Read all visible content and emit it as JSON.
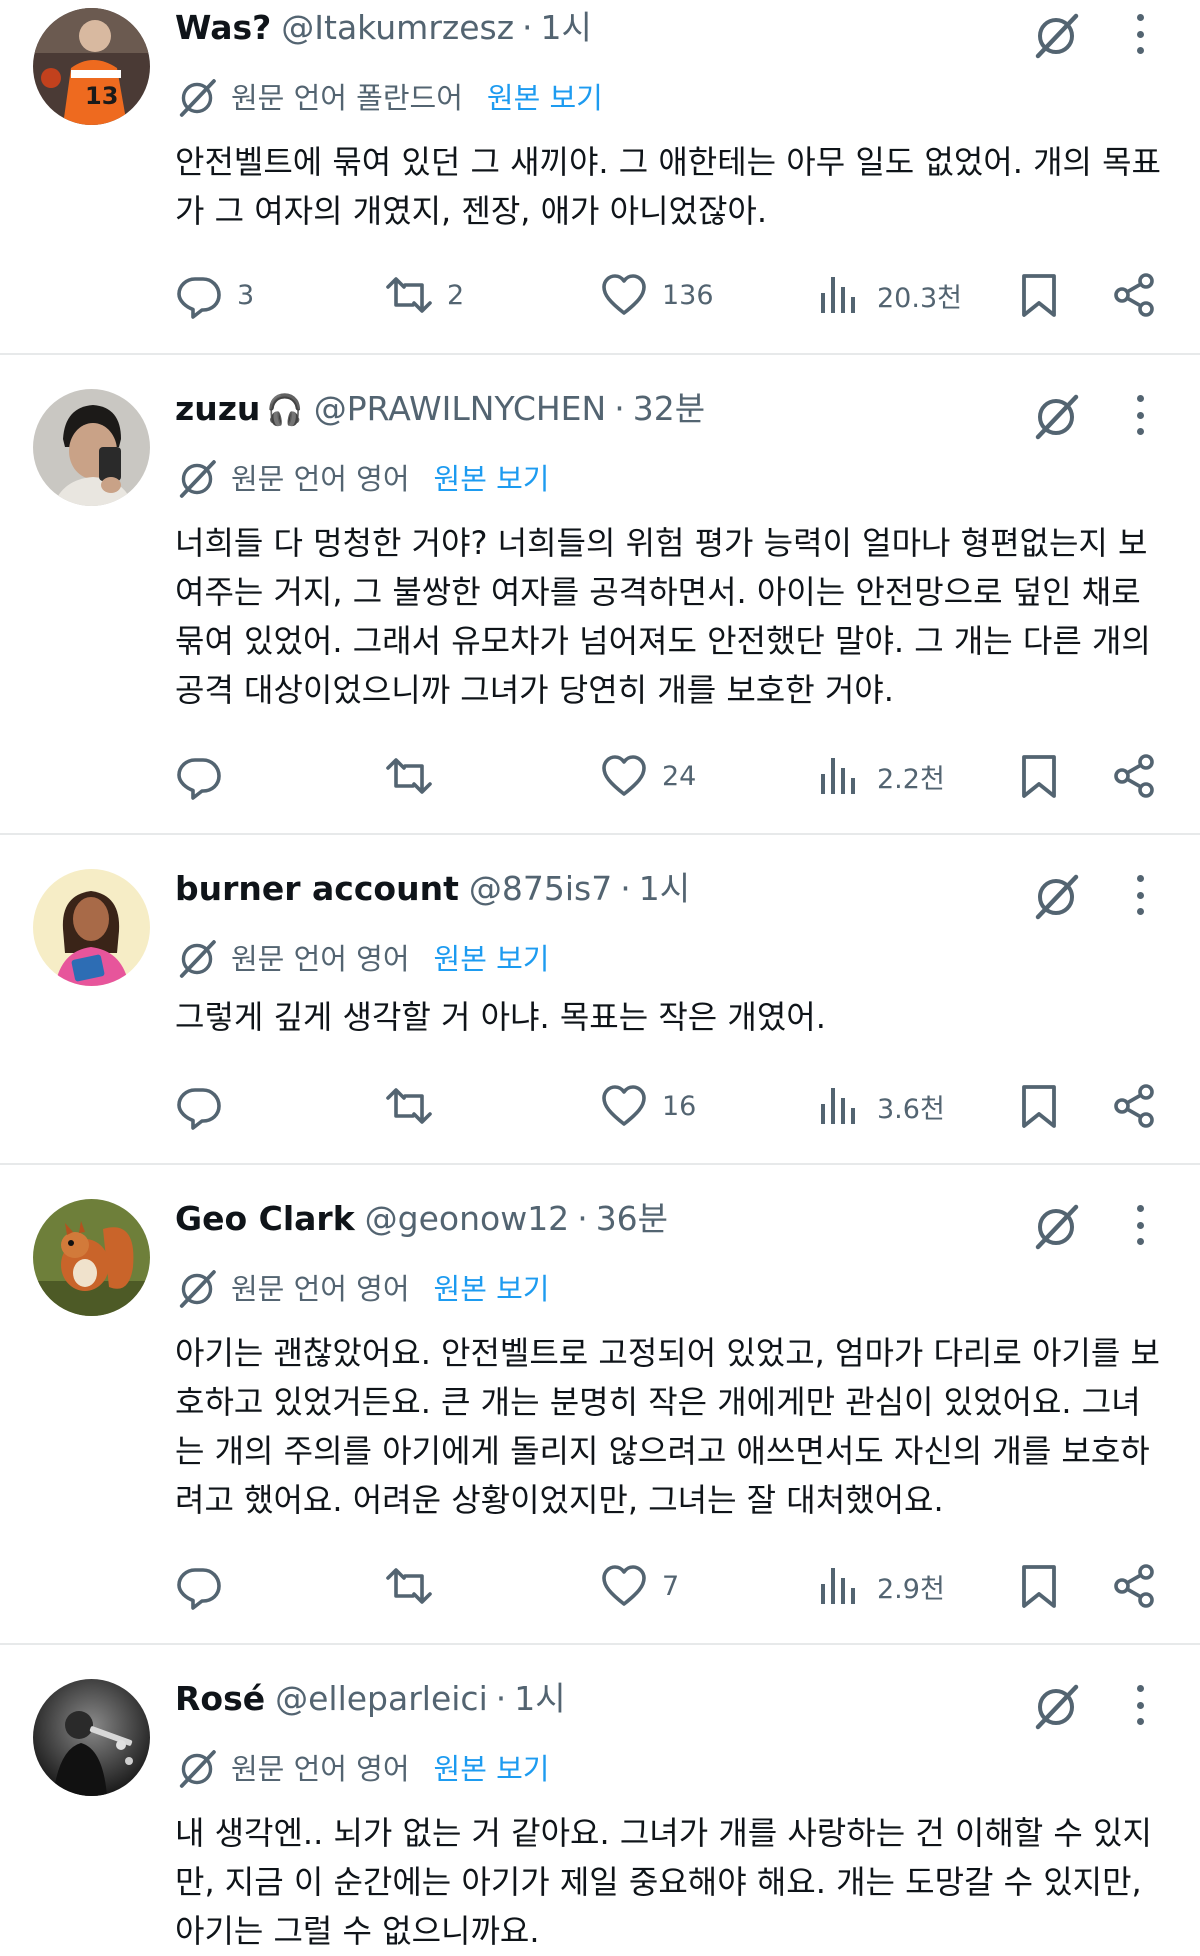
{
  "translate_label": "원본 보기",
  "colors": {
    "text": "#0f1419",
    "secondary": "#536471",
    "link": "#1d9bf0",
    "divider": "#e7e9ea"
  },
  "tweets": [
    {
      "name": "Was?",
      "emoji": "",
      "handle": "@Itakumrzesz",
      "sep": "·",
      "time": "1시",
      "lang": "원문 언어 폴란드어",
      "text": "안전벨트에 묶여 있던 그 새끼야. 그 애한테는 아무 일도 없었어. 개의 목표가 그 여자의 개였지, 젠장, 애가 아니었잖아.",
      "replies": "3",
      "retweets": "2",
      "likes": "136",
      "views": "20.3천",
      "avatar": "hockey-jersey-avatar"
    },
    {
      "name": "zuzu",
      "emoji": "🎧",
      "handle": "@PRAWILNYCHEN",
      "sep": "·",
      "time": "32분",
      "lang": "원문 언어 영어",
      "text": "너희들 다 멍청한 거야? 너희들의 위험 평가 능력이 얼마나 형편없는지 보여주는 거지, 그 불쌍한 여자를 공격하면서. 아이는 안전망으로 덮인 채로 묶여 있었어. 그래서 유모차가 넘어져도 안전했단 말야. 그 개는 다른 개의 공격 대상이었으니까 그녀가 당연히 개를 보호한 거야.",
      "replies": "",
      "retweets": "",
      "likes": "24",
      "views": "2.2천",
      "avatar": "selfie-avatar"
    },
    {
      "name": "burner account",
      "emoji": "",
      "handle": "@875is7",
      "sep": "·",
      "time": "1시",
      "lang": "원문 언어 영어",
      "text": "그렇게 깊게 생각할 거 아냐. 목표는 작은 개였어.",
      "replies": "",
      "retweets": "",
      "likes": "16",
      "views": "3.6천",
      "avatar": "illustrated-woman-avatar"
    },
    {
      "name": "Geo Clark",
      "emoji": "",
      "handle": "@geonow12",
      "sep": "·",
      "time": "36분",
      "lang": "원문 언어 영어",
      "text": "아기는 괜찮았어요. 안전벨트로 고정되어 있었고, 엄마가 다리로 아기를 보호하고 있었거든요. 큰 개는 분명히 작은 개에게만 관심이 있었어요. 그녀는 개의 주의를 아기에게 돌리지 않으려고 애쓰면서도 자신의 개를 보호하려고 했어요. 어려운 상황이었지만, 그녀는 잘 대처했어요.",
      "replies": "",
      "retweets": "",
      "likes": "7",
      "views": "2.9천",
      "avatar": "squirrel-avatar"
    },
    {
      "name": "Rosé",
      "emoji": "",
      "handle": "@elleparleici",
      "sep": "·",
      "time": "1시",
      "lang": "원문 언어 영어",
      "text": "내 생각엔.. 뇌가 없는 거 같아요. 그녀가 개를 사랑하는 건 이해할 수 있지만, 지금 이 순간에는 아기가 제일 중요해야 해요. 개는 도망갈 수 있지만, 아기는 그럴 수 없으니까요.",
      "replies": "",
      "retweets": "",
      "likes": "",
      "views": "",
      "avatar": "musician-avatar"
    }
  ]
}
